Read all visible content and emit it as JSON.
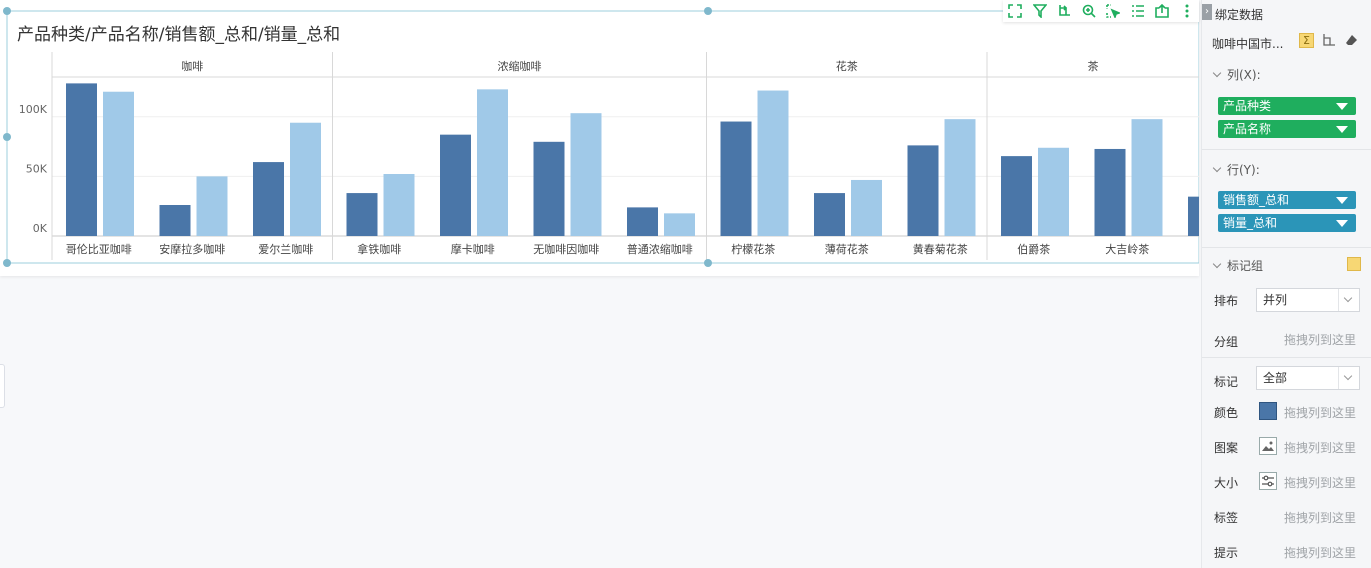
{
  "chart_card": {
    "title": "产品种类/产品名称/销售额_总和/销量_总和"
  },
  "toolbar": {
    "icons": [
      "fullscreen-icon",
      "filter-icon",
      "drill-icon",
      "zoom-icon",
      "select-icon",
      "list-icon",
      "export-icon",
      "more-icon"
    ]
  },
  "panel": {
    "header": "绑定数据",
    "dataset": "咖啡中国市...",
    "columns_label": "列(X):",
    "column_fields": [
      "产品种类",
      "产品名称"
    ],
    "rows_label": "行(Y):",
    "row_fields": [
      "销售额_总和",
      "销量_总和"
    ],
    "mark_group_label": "标记组",
    "layout_label": "排布",
    "layout_value": "并列",
    "group_label": "分组",
    "drop_hint": "拖拽列到这里",
    "mark_label": "标记",
    "mark_value": "全部",
    "color_label": "颜色",
    "pattern_label": "图案",
    "size_label": "大小",
    "tag_label": "标签",
    "tooltip_label": "提示"
  },
  "colors": {
    "sales": "#4a76a8",
    "volume": "#a0c9e8",
    "green": "#1fae5e",
    "blue": "#2b95b8"
  },
  "chart_data": {
    "type": "bar",
    "title": "产品种类/产品名称/销售额_总和/销量_总和",
    "y_ticks": [
      "0K",
      "50K",
      "100K"
    ],
    "ylim": [
      0,
      130000
    ],
    "groups": [
      {
        "name": "咖啡",
        "categories": [
          "哥伦比亚咖啡",
          "安摩拉多咖啡",
          "爱尔兰咖啡"
        ]
      },
      {
        "name": "浓缩咖啡",
        "categories": [
          "拿铁咖啡",
          "摩卡咖啡",
          "无咖啡因咖啡",
          "普通浓缩咖啡"
        ]
      },
      {
        "name": "花茶",
        "categories": [
          "柠檬花茶",
          "薄荷花茶",
          "黄春菊花茶"
        ]
      },
      {
        "name": "茶",
        "categories": [
          "伯爵茶",
          "大吉岭茶",
          ""
        ]
      }
    ],
    "series": [
      {
        "values": [
          128000,
          26000,
          62000,
          36000,
          85000,
          79000,
          24000,
          96000,
          36000,
          76000,
          67000,
          73000,
          33000
        ]
      },
      {
        "values": [
          121000,
          50000,
          95000,
          52000,
          123000,
          103000,
          19000,
          122000,
          47000,
          98000,
          74000,
          98000,
          0
        ]
      }
    ]
  }
}
